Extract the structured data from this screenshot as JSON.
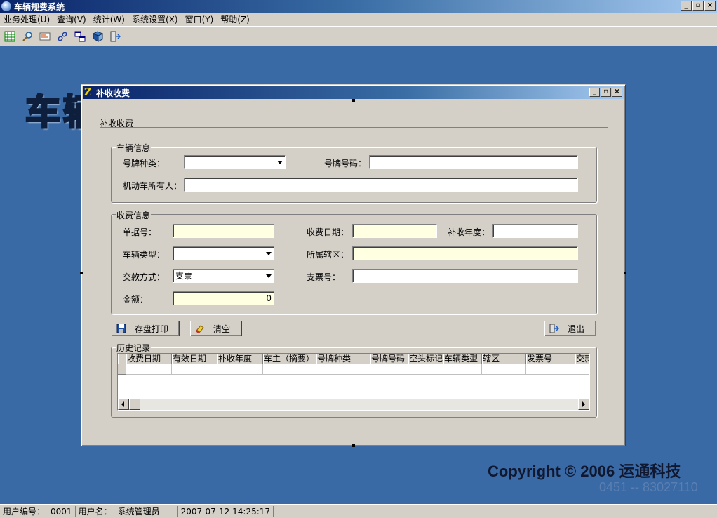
{
  "app": {
    "title": "车辆规费系统"
  },
  "window_buttons": {
    "minimize": "_",
    "restore": "▫",
    "close": "×"
  },
  "menu": [
    {
      "label": "业务处理(U)"
    },
    {
      "label": "查询(V)"
    },
    {
      "label": "统计(W)"
    },
    {
      "label": "系统设置(X)"
    },
    {
      "label": "窗口(Y)"
    },
    {
      "label": "帮助(Z)"
    }
  ],
  "toolbar": {
    "icons": [
      "spreadsheet-icon",
      "search-icon",
      "card-icon",
      "link-icon",
      "windows-icon",
      "book-icon",
      "exit-icon"
    ]
  },
  "desktop": {
    "logo_text": "车辆",
    "copyright": "Copyright © 2006 运通科技",
    "phone": "0451 -- 83027110"
  },
  "dialog": {
    "title": "补收收费",
    "section_title": "补收收费",
    "vehicle_group": {
      "legend": "车辆信息",
      "plate_type_label": "号牌种类：",
      "plate_type_value": "",
      "plate_number_label": "号牌号码：",
      "plate_number_value": "",
      "owner_label": "机动车所有人：",
      "owner_value": ""
    },
    "fee_group": {
      "legend": "收费信息",
      "receipt_label": "单据号：",
      "receipt_value": "",
      "fee_date_label": "收费日期：",
      "fee_date_value": "",
      "supp_year_label": "补收年度：",
      "supp_year_value": "",
      "vehicle_type_label": "车辆类型：",
      "vehicle_type_value": "",
      "district_label": "所属辖区：",
      "district_value": "",
      "payment_label": "交款方式：",
      "payment_value": "支票",
      "check_no_label": "支票号：",
      "check_no_value": "",
      "amount_label": "金额：",
      "amount_value": "0"
    },
    "buttons": {
      "save_print": "存盘打印",
      "clear": "清空",
      "exit": "退出"
    },
    "history": {
      "legend": "历史记录",
      "columns": [
        "收费日期",
        "有效日期",
        "补收年度",
        "车主（摘要）",
        "号牌种类",
        "号牌号码",
        "空头标记",
        "车辆类型",
        "辖区",
        "发票号",
        "交款"
      ]
    }
  },
  "status": {
    "user_id_label": "用户编号：",
    "user_id": "0001",
    "user_name_label": "用户名：",
    "user_name": "系统管理员",
    "datetime": "2007-07-12 14:25:17"
  },
  "colors": {
    "desktop": "#3a6aa6",
    "titlebar": "#0a246a",
    "readonly_field": "#ffffe1"
  }
}
